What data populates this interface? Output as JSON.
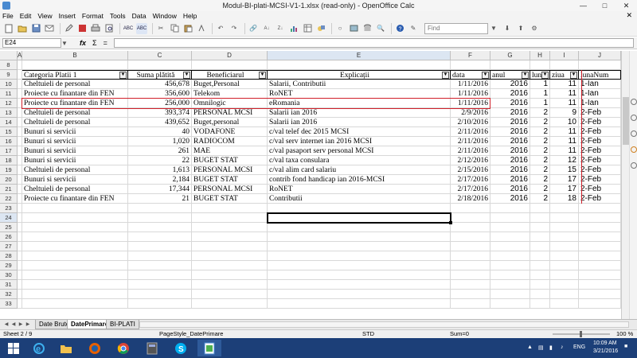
{
  "window": {
    "title": "Modul-BI-plati-MCSI-V1-1.xlsx (read-only) - OpenOffice Calc"
  },
  "menu": [
    "File",
    "Edit",
    "View",
    "Insert",
    "Format",
    "Tools",
    "Data",
    "Window",
    "Help"
  ],
  "toolbar": {
    "find_placeholder": "Find"
  },
  "formula_bar": {
    "cell_ref": "E24",
    "fx": "fx",
    "sigma": "Σ",
    "equals": "="
  },
  "columns": [
    "A",
    "B",
    "C",
    "D",
    "E",
    "F",
    "G",
    "H",
    "I",
    "J"
  ],
  "rows": [
    "8",
    "9",
    "10",
    "11",
    "12",
    "13",
    "14",
    "15",
    "16",
    "17",
    "18",
    "19",
    "20",
    "21",
    "22",
    "23",
    "24",
    "25",
    "26",
    "27",
    "28",
    "29",
    "30",
    "31",
    "32",
    "33"
  ],
  "header_row": [
    "Categoria Platii 1",
    "Suma plătită",
    "Beneficiarul",
    "Explicații",
    "data",
    "anul",
    "luna",
    "ziua",
    "lunaNum"
  ],
  "data_rows": [
    [
      "Cheltuieli de personal",
      "456,678",
      "Buget,Personal",
      "Salarii, Contributii",
      "1/11/2016",
      "2016",
      "1",
      "11",
      "1-Ian"
    ],
    [
      "Proiecte cu finantare din FEN",
      "356,600",
      "Telekom",
      "RoNET",
      "1/11/2016",
      "2016",
      "1",
      "11",
      "1-Ian"
    ],
    [
      "Proiecte cu finantare din FEN",
      "256,000",
      "Omnilogic",
      "eRomania",
      "1/11/2016",
      "2016",
      "1",
      "11",
      "1-Ian"
    ],
    [
      "Cheltuieli de personal",
      "393,374",
      "PERSONAL MCSI",
      "Salarii ian 2016",
      "2/9/2016",
      "2016",
      "2",
      "9",
      "2-Feb"
    ],
    [
      "Cheltuieli de personal",
      "439,652",
      "Buget,personal",
      "Salarii ian 2016",
      "2/10/2016",
      "2016",
      "2",
      "10",
      "2-Feb"
    ],
    [
      "Bunuri si servicii",
      "40",
      "VODAFONE",
      "c/val telef dec 2015 MCSI",
      "2/11/2016",
      "2016",
      "2",
      "11",
      "2-Feb"
    ],
    [
      "Bunuri si servicii",
      "1,020",
      "RADIOCOM",
      "c/val serv internet ian 2016 MCSI",
      "2/11/2016",
      "2016",
      "2",
      "11",
      "2-Feb"
    ],
    [
      "Bunuri si servicii",
      "261",
      "MAE",
      "c/val pasaport serv personal MCSI",
      "2/11/2016",
      "2016",
      "2",
      "11",
      "2-Feb"
    ],
    [
      "Bunuri si servicii",
      "22",
      "BUGET STAT",
      "c/val taxa consulara",
      "2/12/2016",
      "2016",
      "2",
      "12",
      "2-Feb"
    ],
    [
      "Cheltuieli de personal",
      "1,613",
      "PERSONAL MCSI",
      "c/val alim card salariu",
      "2/15/2016",
      "2016",
      "2",
      "15",
      "2-Feb"
    ],
    [
      "Bunuri si servicii",
      "2,184",
      "BUGET STAT",
      "contrib fond handicap ian 2016-MCSI",
      "2/17/2016",
      "2016",
      "2",
      "17",
      "2-Feb"
    ],
    [
      "Cheltuieli de personal",
      "17,344",
      "PERSONAL MCSI",
      "RoNET",
      "2/17/2016",
      "2016",
      "2",
      "17",
      "2-Feb"
    ],
    [
      "Proiecte cu finantare din FEN",
      "21",
      "BUGET STAT",
      "Contributii",
      "2/18/2016",
      "2016",
      "2",
      "18",
      "2-Feb"
    ]
  ],
  "tabs": [
    "Date Brute",
    "DatePrimare",
    "BI-PLATI"
  ],
  "status": {
    "sheet": "Sheet 2 / 9",
    "page_style": "PageStyle_DatePrimare",
    "mode": "STD",
    "sum": "Sum=0",
    "zoom": "100 %"
  },
  "tray": {
    "lang": "ENG",
    "time": "10:09 AM",
    "date": "3/21/2016"
  },
  "colors": {
    "highlight_border": "#d0202a",
    "taskbar": "#1c3f78"
  }
}
